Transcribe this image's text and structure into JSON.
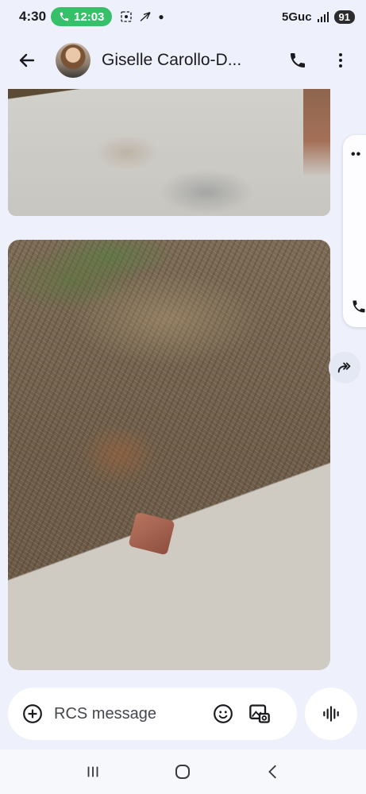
{
  "status_bar": {
    "time": "4:30",
    "call_timer": "12:03",
    "network": "5Guc",
    "battery": "91"
  },
  "header": {
    "contact_name": "Giselle Carollo-D..."
  },
  "conversation": {
    "messages": [
      {
        "type": "image",
        "description_icon": "photo"
      },
      {
        "type": "image",
        "description_icon": "photo"
      }
    ]
  },
  "composer": {
    "placeholder": "RCS message"
  },
  "colors": {
    "call_pill": "#36c06a",
    "background": "#eef1fb",
    "battery": "#2c2c2e"
  },
  "icons": [
    "back-arrow-icon",
    "phone-icon",
    "more-vert-icon",
    "add-circle-icon",
    "emoji-icon",
    "gallery-icon",
    "voice-wave-icon",
    "forward-icon",
    "recents-icon",
    "home-icon",
    "nav-back-icon"
  ]
}
